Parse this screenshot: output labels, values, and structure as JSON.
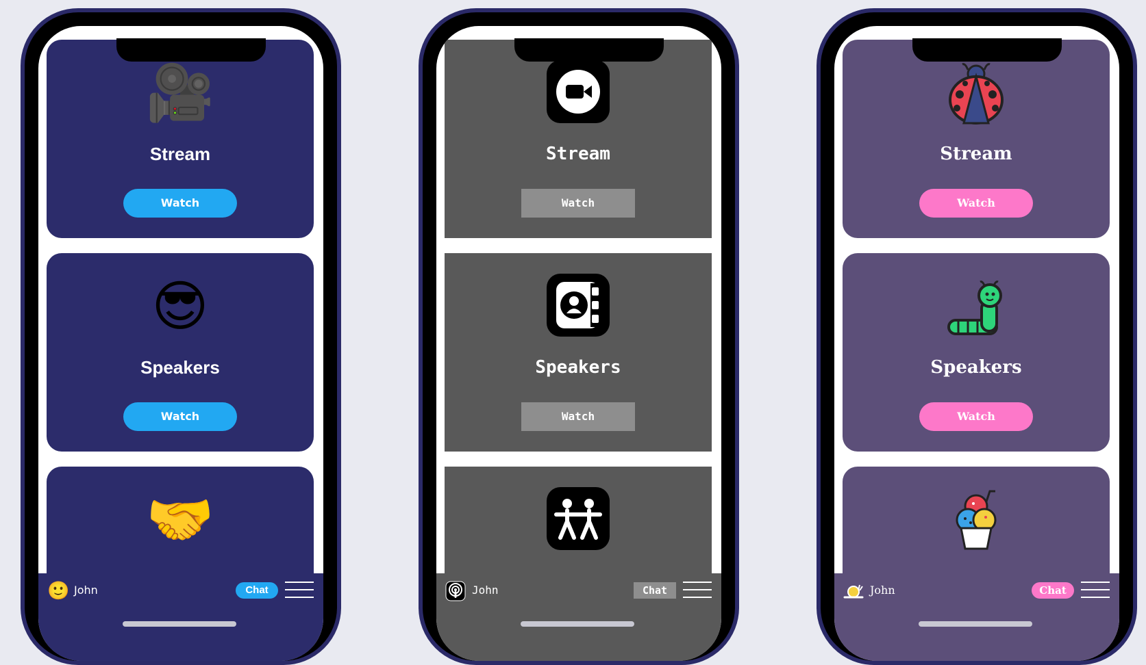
{
  "phones": [
    {
      "cards": [
        {
          "icon": "movie-camera-icon",
          "glyph": "🎥",
          "title": "Stream",
          "button": "Watch"
        },
        {
          "icon": "sunglasses-face-icon",
          "glyph": "😎",
          "title": "Speakers",
          "button": "Watch"
        },
        {
          "icon": "handshake-icon",
          "glyph": "🤝"
        }
      ],
      "footer": {
        "avatar_icon": "smiley-face-icon",
        "avatar_glyph": "🙂",
        "user": "John",
        "chat": "Chat",
        "menu_icon": "hamburger-menu-icon"
      },
      "colors": {
        "card": "#2c2c6b",
        "accent": "#22a8f2"
      }
    },
    {
      "cards": [
        {
          "icon": "video-camera-icon",
          "title": "Stream",
          "button": "Watch"
        },
        {
          "icon": "contact-book-icon",
          "title": "Speakers",
          "button": "Watch"
        },
        {
          "icon": "two-people-icon"
        }
      ],
      "footer": {
        "avatar_icon": "podcast-icon",
        "user": "John",
        "chat": "Chat",
        "menu_icon": "hamburger-menu-icon"
      },
      "colors": {
        "card": "#595959",
        "accent": "#8e8e8e"
      }
    },
    {
      "cards": [
        {
          "icon": "ladybug-icon",
          "title": "Stream",
          "button": "Watch"
        },
        {
          "icon": "caterpillar-icon",
          "title": "Speakers",
          "button": "Watch"
        },
        {
          "icon": "ice-cream-icon"
        }
      ],
      "footer": {
        "avatar_icon": "snail-icon",
        "user": "John",
        "chat": "Chat",
        "menu_icon": "hamburger-menu-icon"
      },
      "colors": {
        "card": "#5c4f79",
        "accent": "#fd78c9"
      }
    }
  ]
}
